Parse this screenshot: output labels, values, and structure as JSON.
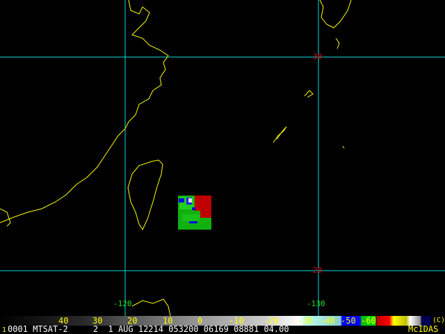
{
  "grid": {
    "lat_labels": [
      "30",
      "20"
    ],
    "lon_labels": [
      "-120",
      "-130"
    ]
  },
  "colorbar": {
    "ticks": [
      "40",
      "30",
      "20",
      "10",
      "0",
      "-10",
      "-20",
      "-30",
      "-40",
      "-50",
      "-60"
    ],
    "copyright": "(C)"
  },
  "info": {
    "frame": "1",
    "line": "0001 MTSAT-2     2  1 AUG 12214 053200 06169 08881 04.00",
    "brand": "McIDAS"
  },
  "colors": {
    "grid": "#00e0e0",
    "coast": "#ffff00",
    "lat_label": "#e00000",
    "lon_label": "#20e020"
  }
}
